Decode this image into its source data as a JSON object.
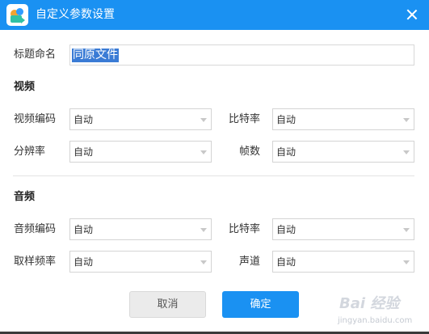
{
  "window": {
    "title": "自定义参数设置"
  },
  "name_field": {
    "label": "标题命名",
    "value": "同原文件"
  },
  "video": {
    "heading": "视频",
    "codec": {
      "label": "视频编码",
      "value": "自动"
    },
    "bitrate": {
      "label": "比特率",
      "value": "自动"
    },
    "resolution": {
      "label": "分辨率",
      "value": "自动"
    },
    "framerate": {
      "label": "帧数",
      "value": "自动"
    }
  },
  "audio": {
    "heading": "音频",
    "codec": {
      "label": "音频编码",
      "value": "自动"
    },
    "bitrate": {
      "label": "比特率",
      "value": "自动"
    },
    "samplerate": {
      "label": "取样频率",
      "value": "自动"
    },
    "channel": {
      "label": "声道",
      "value": "自动"
    }
  },
  "buttons": {
    "cancel": "取消",
    "ok": "确定"
  },
  "watermark": {
    "main": "Bai 经验",
    "sub": "jingyan.baidu.com"
  },
  "colors": {
    "accent": "#1a91f2",
    "selection": "#3a7bd5"
  }
}
